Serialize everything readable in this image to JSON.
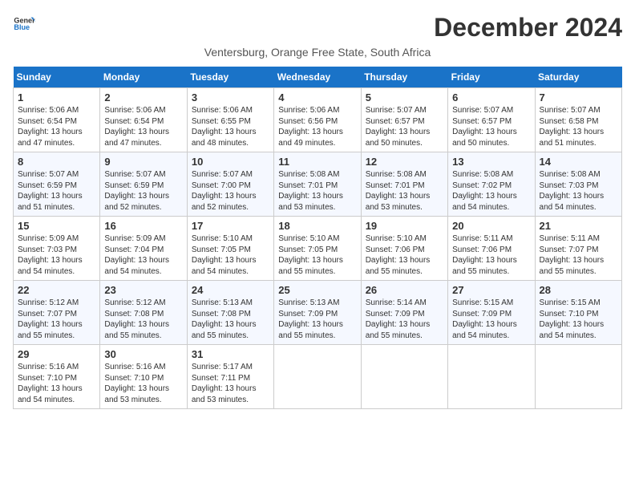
{
  "logo": {
    "line1": "General",
    "line2": "Blue"
  },
  "title": "December 2024",
  "subtitle": "Ventersburg, Orange Free State, South Africa",
  "days_of_week": [
    "Sunday",
    "Monday",
    "Tuesday",
    "Wednesday",
    "Thursday",
    "Friday",
    "Saturday"
  ],
  "weeks": [
    [
      {
        "day": 1,
        "sunrise": "5:06 AM",
        "sunset": "6:54 PM",
        "daylight": "13 hours and 47 minutes."
      },
      {
        "day": 2,
        "sunrise": "5:06 AM",
        "sunset": "6:54 PM",
        "daylight": "13 hours and 47 minutes."
      },
      {
        "day": 3,
        "sunrise": "5:06 AM",
        "sunset": "6:55 PM",
        "daylight": "13 hours and 48 minutes."
      },
      {
        "day": 4,
        "sunrise": "5:06 AM",
        "sunset": "6:56 PM",
        "daylight": "13 hours and 49 minutes."
      },
      {
        "day": 5,
        "sunrise": "5:07 AM",
        "sunset": "6:57 PM",
        "daylight": "13 hours and 50 minutes."
      },
      {
        "day": 6,
        "sunrise": "5:07 AM",
        "sunset": "6:57 PM",
        "daylight": "13 hours and 50 minutes."
      },
      {
        "day": 7,
        "sunrise": "5:07 AM",
        "sunset": "6:58 PM",
        "daylight": "13 hours and 51 minutes."
      }
    ],
    [
      {
        "day": 8,
        "sunrise": "5:07 AM",
        "sunset": "6:59 PM",
        "daylight": "13 hours and 51 minutes."
      },
      {
        "day": 9,
        "sunrise": "5:07 AM",
        "sunset": "6:59 PM",
        "daylight": "13 hours and 52 minutes."
      },
      {
        "day": 10,
        "sunrise": "5:07 AM",
        "sunset": "7:00 PM",
        "daylight": "13 hours and 52 minutes."
      },
      {
        "day": 11,
        "sunrise": "5:08 AM",
        "sunset": "7:01 PM",
        "daylight": "13 hours and 53 minutes."
      },
      {
        "day": 12,
        "sunrise": "5:08 AM",
        "sunset": "7:01 PM",
        "daylight": "13 hours and 53 minutes."
      },
      {
        "day": 13,
        "sunrise": "5:08 AM",
        "sunset": "7:02 PM",
        "daylight": "13 hours and 54 minutes."
      },
      {
        "day": 14,
        "sunrise": "5:08 AM",
        "sunset": "7:03 PM",
        "daylight": "13 hours and 54 minutes."
      }
    ],
    [
      {
        "day": 15,
        "sunrise": "5:09 AM",
        "sunset": "7:03 PM",
        "daylight": "13 hours and 54 minutes."
      },
      {
        "day": 16,
        "sunrise": "5:09 AM",
        "sunset": "7:04 PM",
        "daylight": "13 hours and 54 minutes."
      },
      {
        "day": 17,
        "sunrise": "5:10 AM",
        "sunset": "7:05 PM",
        "daylight": "13 hours and 54 minutes."
      },
      {
        "day": 18,
        "sunrise": "5:10 AM",
        "sunset": "7:05 PM",
        "daylight": "13 hours and 55 minutes."
      },
      {
        "day": 19,
        "sunrise": "5:10 AM",
        "sunset": "7:06 PM",
        "daylight": "13 hours and 55 minutes."
      },
      {
        "day": 20,
        "sunrise": "5:11 AM",
        "sunset": "7:06 PM",
        "daylight": "13 hours and 55 minutes."
      },
      {
        "day": 21,
        "sunrise": "5:11 AM",
        "sunset": "7:07 PM",
        "daylight": "13 hours and 55 minutes."
      }
    ],
    [
      {
        "day": 22,
        "sunrise": "5:12 AM",
        "sunset": "7:07 PM",
        "daylight": "13 hours and 55 minutes."
      },
      {
        "day": 23,
        "sunrise": "5:12 AM",
        "sunset": "7:08 PM",
        "daylight": "13 hours and 55 minutes."
      },
      {
        "day": 24,
        "sunrise": "5:13 AM",
        "sunset": "7:08 PM",
        "daylight": "13 hours and 55 minutes."
      },
      {
        "day": 25,
        "sunrise": "5:13 AM",
        "sunset": "7:09 PM",
        "daylight": "13 hours and 55 minutes."
      },
      {
        "day": 26,
        "sunrise": "5:14 AM",
        "sunset": "7:09 PM",
        "daylight": "13 hours and 55 minutes."
      },
      {
        "day": 27,
        "sunrise": "5:15 AM",
        "sunset": "7:09 PM",
        "daylight": "13 hours and 54 minutes."
      },
      {
        "day": 28,
        "sunrise": "5:15 AM",
        "sunset": "7:10 PM",
        "daylight": "13 hours and 54 minutes."
      }
    ],
    [
      {
        "day": 29,
        "sunrise": "5:16 AM",
        "sunset": "7:10 PM",
        "daylight": "13 hours and 54 minutes."
      },
      {
        "day": 30,
        "sunrise": "5:16 AM",
        "sunset": "7:10 PM",
        "daylight": "13 hours and 53 minutes."
      },
      {
        "day": 31,
        "sunrise": "5:17 AM",
        "sunset": "7:11 PM",
        "daylight": "13 hours and 53 minutes."
      },
      null,
      null,
      null,
      null
    ]
  ]
}
